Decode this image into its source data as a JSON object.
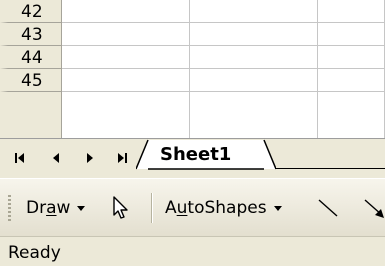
{
  "grid": {
    "rows": [
      "42",
      "43",
      "44",
      "45"
    ]
  },
  "sheet_tabs": {
    "active_tab": "Sheet1",
    "nav_buttons": [
      "first-sheet",
      "previous-sheet",
      "next-sheet",
      "last-sheet"
    ]
  },
  "drawing_toolbar": {
    "draw_button": "Draw",
    "autoshapes_button": "AutoShapes",
    "icons": [
      "select-objects-arrow-icon",
      "line-icon",
      "arrow-icon"
    ]
  },
  "status_bar": {
    "status": "Ready"
  }
}
